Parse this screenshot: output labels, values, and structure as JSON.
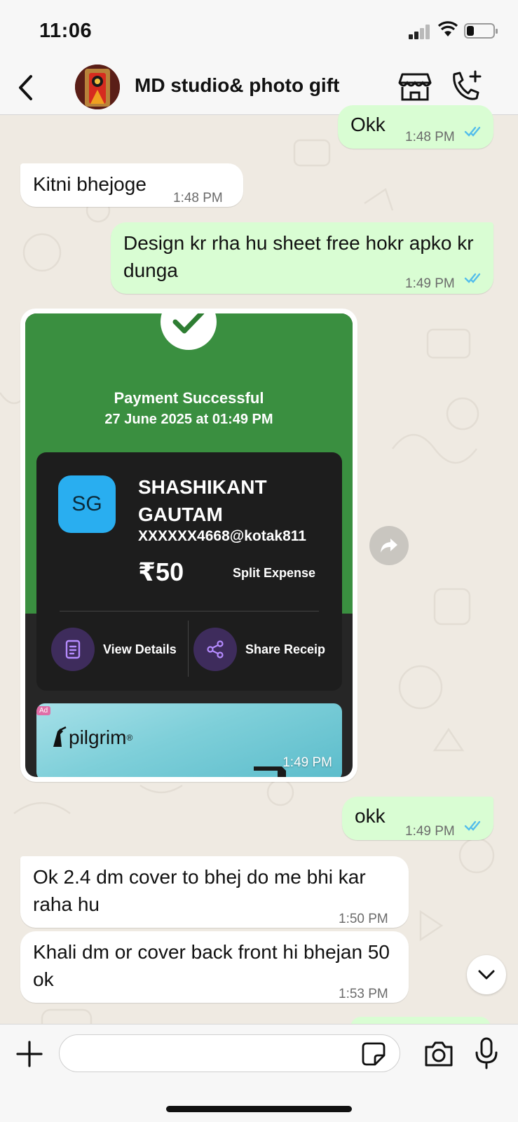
{
  "status_bar": {
    "time": "11:06",
    "battery_level": 0.28,
    "signal_bars": 2
  },
  "header": {
    "back_icon": "chevron-left-icon",
    "contact_name": "MD studio& photo gift",
    "store_icon": "store-icon",
    "call_icon": "add-call-icon"
  },
  "messages": [
    {
      "direction": "out",
      "text": "Okk",
      "time": "1:48 PM",
      "read": true
    },
    {
      "direction": "in",
      "text": "Kitni bhejoge",
      "time": "1:48 PM"
    },
    {
      "direction": "out",
      "text": "Design kr rha hu sheet free hokr apko kr dunga",
      "time": "1:49 PM",
      "read": true
    },
    {
      "direction": "out",
      "text": "okk",
      "time": "1:49 PM",
      "read": true
    },
    {
      "direction": "in",
      "text": "Ok 2.4 dm cover to bhej do me bhi kar raha hu",
      "time": "1:50 PM"
    },
    {
      "direction": "in",
      "text": "Khali dm or cover back front hi bhejan 50 ok",
      "time": "1:53 PM"
    }
  ],
  "payment_image": {
    "time": "1:49 PM",
    "status": "Payment Successful",
    "date": "27 June 2025 at 01:49 PM",
    "payee_initials": "SG",
    "payee_name": "SHASHIKANT GAUTAM",
    "payee_upi": "XXXXXX4668@kotak811",
    "amount": "₹50",
    "note": "Split Expense",
    "action_view": "View Details",
    "action_share": "Share Receip",
    "ad_tag": "Ad",
    "ad_brand": "pilgrim",
    "ad_brand_mark": "®"
  },
  "input": {
    "placeholder": ""
  },
  "colors": {
    "chat_bg": "#efeae2",
    "outgoing_bubble": "#d9fdd3",
    "incoming_bubble": "#ffffff",
    "read_tick": "#53bdeb",
    "payment_green": "#3a8f40",
    "payment_card": "#1d1d1d",
    "payee_avatar": "#29aef0"
  }
}
